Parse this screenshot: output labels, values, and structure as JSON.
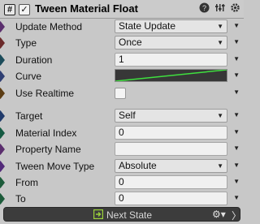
{
  "header": {
    "hash_glyph": "#",
    "enabled_glyph": "✓",
    "title": "Tween Material Float",
    "icons": [
      "help-icon",
      "preset-icon",
      "settings-icon"
    ]
  },
  "rows": [
    {
      "label": "Update Method",
      "kind": "dropdown",
      "value": "State Update",
      "color": "#5b2f6e"
    },
    {
      "label": "Type",
      "kind": "dropdown",
      "value": "Once",
      "color": "#6b2a2a"
    },
    {
      "label": "Duration",
      "kind": "text",
      "value": "1",
      "color": "#1c4c5a"
    },
    {
      "label": "Curve",
      "kind": "curve",
      "value": "",
      "color": "#2f3f73"
    },
    {
      "label": "Use Realtime",
      "kind": "checkbox",
      "value": "",
      "color": "#5b3c13"
    },
    {
      "label": "Target",
      "kind": "dropdown",
      "value": "Self",
      "color": "#203a6b"
    },
    {
      "label": "Material Index",
      "kind": "text",
      "value": "0",
      "color": "#145a42"
    },
    {
      "label": "Property Name",
      "kind": "text",
      "value": "",
      "color": "#5b2f6e"
    },
    {
      "label": "Tween Move Type",
      "kind": "dropdown",
      "value": "Absolute",
      "color": "#532b7a"
    },
    {
      "label": "From",
      "kind": "text",
      "value": "0",
      "color": "#1c5b3a"
    },
    {
      "label": "To",
      "kind": "text",
      "value": "0",
      "color": "#1c5b3a"
    }
  ],
  "footer": {
    "label": "Next State",
    "icon_color": "#9bd23a"
  },
  "colors": {
    "curve_line": "#3fe03f",
    "curve_bg": "#373737"
  }
}
